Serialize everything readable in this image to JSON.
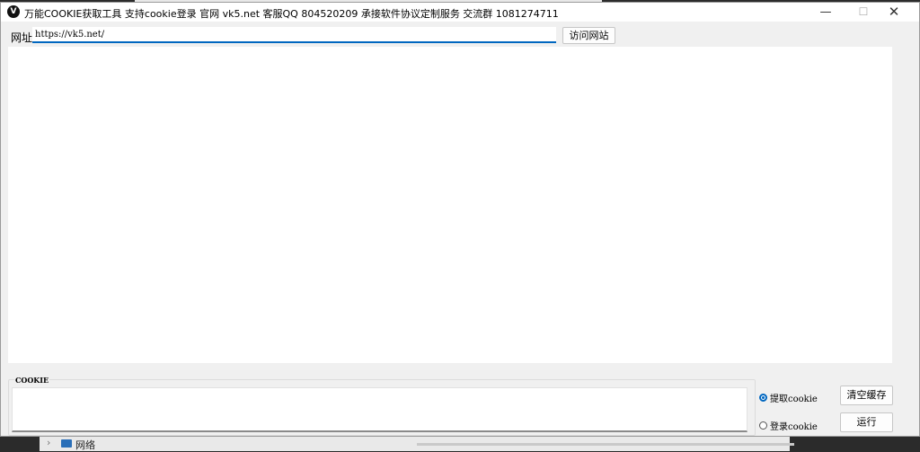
{
  "window": {
    "title": "万能COOKIE获取工具 支持cookie登录 官网 vk5.net 客服QQ 804520209 承接软件协议定制服务 交流群 1081274711",
    "controls": {
      "minimize": "—",
      "maximize": "☐",
      "close": "✕"
    }
  },
  "url_bar": {
    "label": "网址",
    "value": "https://vk5.net/",
    "visit_button": "访问网站"
  },
  "cookie_section": {
    "legend": "COOKIE",
    "value": ""
  },
  "options": [
    {
      "label": "提取cookie",
      "checked": true
    },
    {
      "label": "登录cookie",
      "checked": false
    }
  ],
  "actions": {
    "clear_cache": "清空缓存",
    "run": "运行"
  },
  "background": {
    "explorer_item": "网络"
  },
  "colors": {
    "accent": "#0067c0",
    "window_bg": "#f0f0f0"
  }
}
